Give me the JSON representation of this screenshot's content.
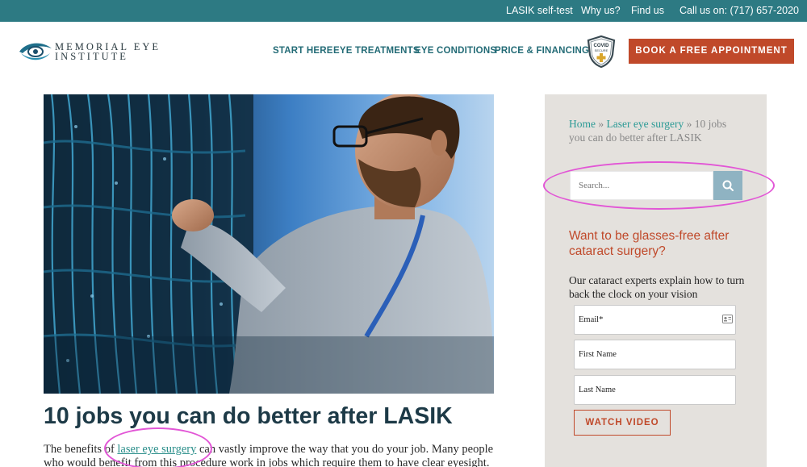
{
  "topbar": {
    "links": [
      "LASIK self-test",
      "Why us?",
      "Find us",
      "Call us on: (717) 657-2020"
    ]
  },
  "brand": {
    "line1": "MEMORIAL EYE",
    "line2": "INSTITUTE"
  },
  "nav": {
    "items": [
      "START HERE",
      "EYE TREATMENTS",
      "EYE CONDITIONS",
      "PRICE & FINANCING"
    ]
  },
  "covid_badge": {
    "line1": "COVID",
    "line2": "SECURE"
  },
  "book_button": "BOOK A FREE APPOINTMENT",
  "article": {
    "title": "10 jobs you can do better after LASIK",
    "body_before_link": "The benefits of ",
    "body_link": "laser eye surgery",
    "body_after_link": " can vastly improve the way that you do your job. Many people",
    "body_line2": "who would benefit from this procedure work in jobs which require them to have clear eyesight."
  },
  "breadcrumb": {
    "home": "Home",
    "sep1": " » ",
    "category": "Laser eye surgery",
    "sep2": " » ",
    "current": "10 jobs you can do better after LASIK"
  },
  "search": {
    "placeholder": "Search..."
  },
  "promo": {
    "title": "Want to be glasses-free after cataract surgery?",
    "text": "Our cataract experts explain how to turn back the clock on your vision"
  },
  "form": {
    "email_placeholder": "Email*",
    "first_name_placeholder": "First Name",
    "last_name_placeholder": "Last Name",
    "submit_label": "WATCH VIDEO"
  },
  "colors": {
    "topbar": "#2d7a83",
    "nav_text": "#236b76",
    "accent": "#c0492a",
    "link": "#2a9a95",
    "sidebar_bg": "#e4e1dd",
    "search_button": "#8fb3c2",
    "annotation": "#e256d6"
  },
  "icons": {
    "search": "search-icon",
    "email_field": "contact-card-icon",
    "logo": "eye-logo-icon",
    "badge": "shield-badge-icon"
  }
}
